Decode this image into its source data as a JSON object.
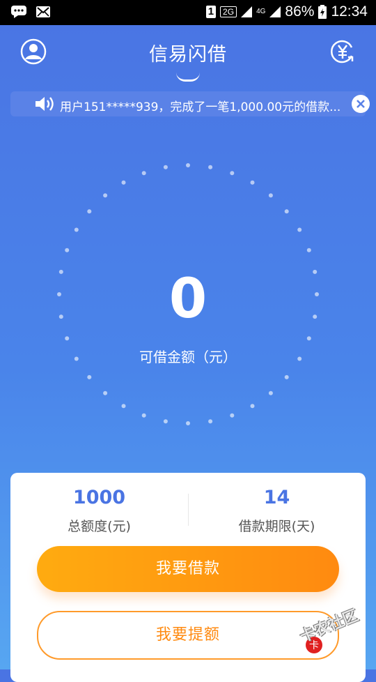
{
  "status_bar": {
    "sim_slot": "1",
    "network_2g": "2G",
    "network_4g": "4G",
    "battery": "86%",
    "time": "12:34"
  },
  "header": {
    "title": "信易闪借",
    "left_icon": "user-icon",
    "right_icon": "yen-refresh-icon"
  },
  "notice": {
    "icon": "speaker-icon",
    "text": "用户151*****939，完成了一笔1,000.00元的借款...",
    "close_icon": "close-icon"
  },
  "main": {
    "amount": "0",
    "amount_label": "可借金额（元）"
  },
  "card": {
    "total_limit_value": "1000",
    "total_limit_label": "总额度(元)",
    "term_value": "14",
    "term_label": "借款期限(天)",
    "borrow_button": "我要借款",
    "raise_button": "我要提额"
  },
  "watermark": {
    "text": "卡农社区"
  },
  "colors": {
    "primary_blue": "#4a74e3",
    "accent_orange": "#ff8a10"
  }
}
